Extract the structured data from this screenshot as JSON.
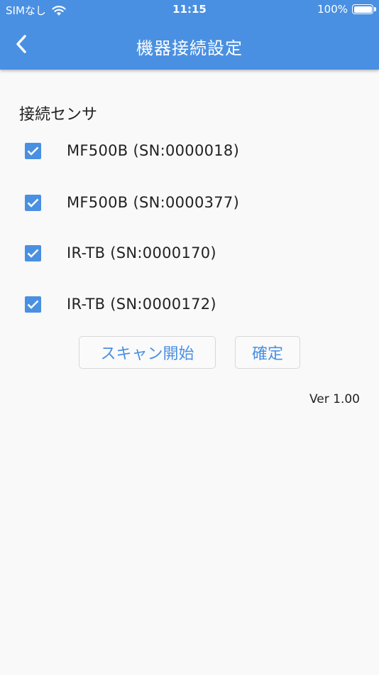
{
  "status_bar": {
    "carrier": "SIMなし",
    "time": "11:15",
    "battery_percent": "100%",
    "battery_level": 1.0
  },
  "nav": {
    "title": "機器接続設定",
    "back_icon": "chevron-left-icon"
  },
  "section": {
    "label": "接続センサ"
  },
  "sensors": [
    {
      "label": "MF500B (SN:0000018)",
      "checked": true
    },
    {
      "label": "MF500B (SN:0000377)",
      "checked": true
    },
    {
      "label": "IR-TB (SN:0000170)",
      "checked": true
    },
    {
      "label": "IR-TB (SN:0000172)",
      "checked": true
    }
  ],
  "buttons": {
    "scan_label": "スキャン開始",
    "confirm_label": "確定"
  },
  "footer": {
    "version": "Ver 1.00"
  },
  "colors": {
    "accent": "#4a90e2",
    "background": "#f9f9f9",
    "text": "#222222"
  }
}
